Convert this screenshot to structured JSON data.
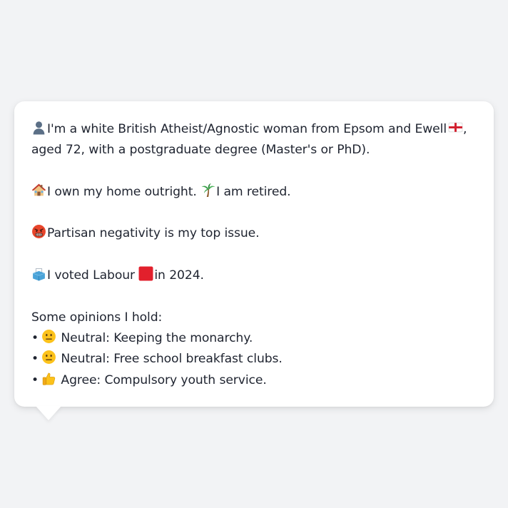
{
  "profile": {
    "identity": {
      "icon": "person-silhouette-icon",
      "line1_text": "I'm a white British Atheist/Agnostic woman from Epsom and Ewell",
      "flag_icon": "england-flag-icon",
      "line1_tail": ",",
      "line2_text": "aged 72, with a postgraduate degree (Master's or PhD)."
    },
    "home": {
      "home_icon": "house-icon",
      "home_text": "I own my home outright.",
      "work_icon": "palm-tree-icon",
      "work_text": "I am retired."
    },
    "issue": {
      "icon": "angry-face-icon",
      "text": "Partisan negativity is my top issue."
    },
    "vote": {
      "icon": "ballot-box-icon",
      "text_before": "I voted Labour",
      "party_icon": "red-square-icon",
      "party_color": "#e2202c",
      "text_after": "in 2024."
    },
    "opinions": {
      "heading": "Some opinions I hold:",
      "items": [
        {
          "bullet": "•",
          "icon": "neutral-face-icon",
          "text": "Neutral: Keeping the monarchy."
        },
        {
          "bullet": "•",
          "icon": "neutral-face-icon",
          "text": "Neutral: Free school breakfast clubs."
        },
        {
          "bullet": "•",
          "icon": "thumbs-up-icon",
          "text": "Agree: Compulsory youth service."
        }
      ]
    }
  }
}
